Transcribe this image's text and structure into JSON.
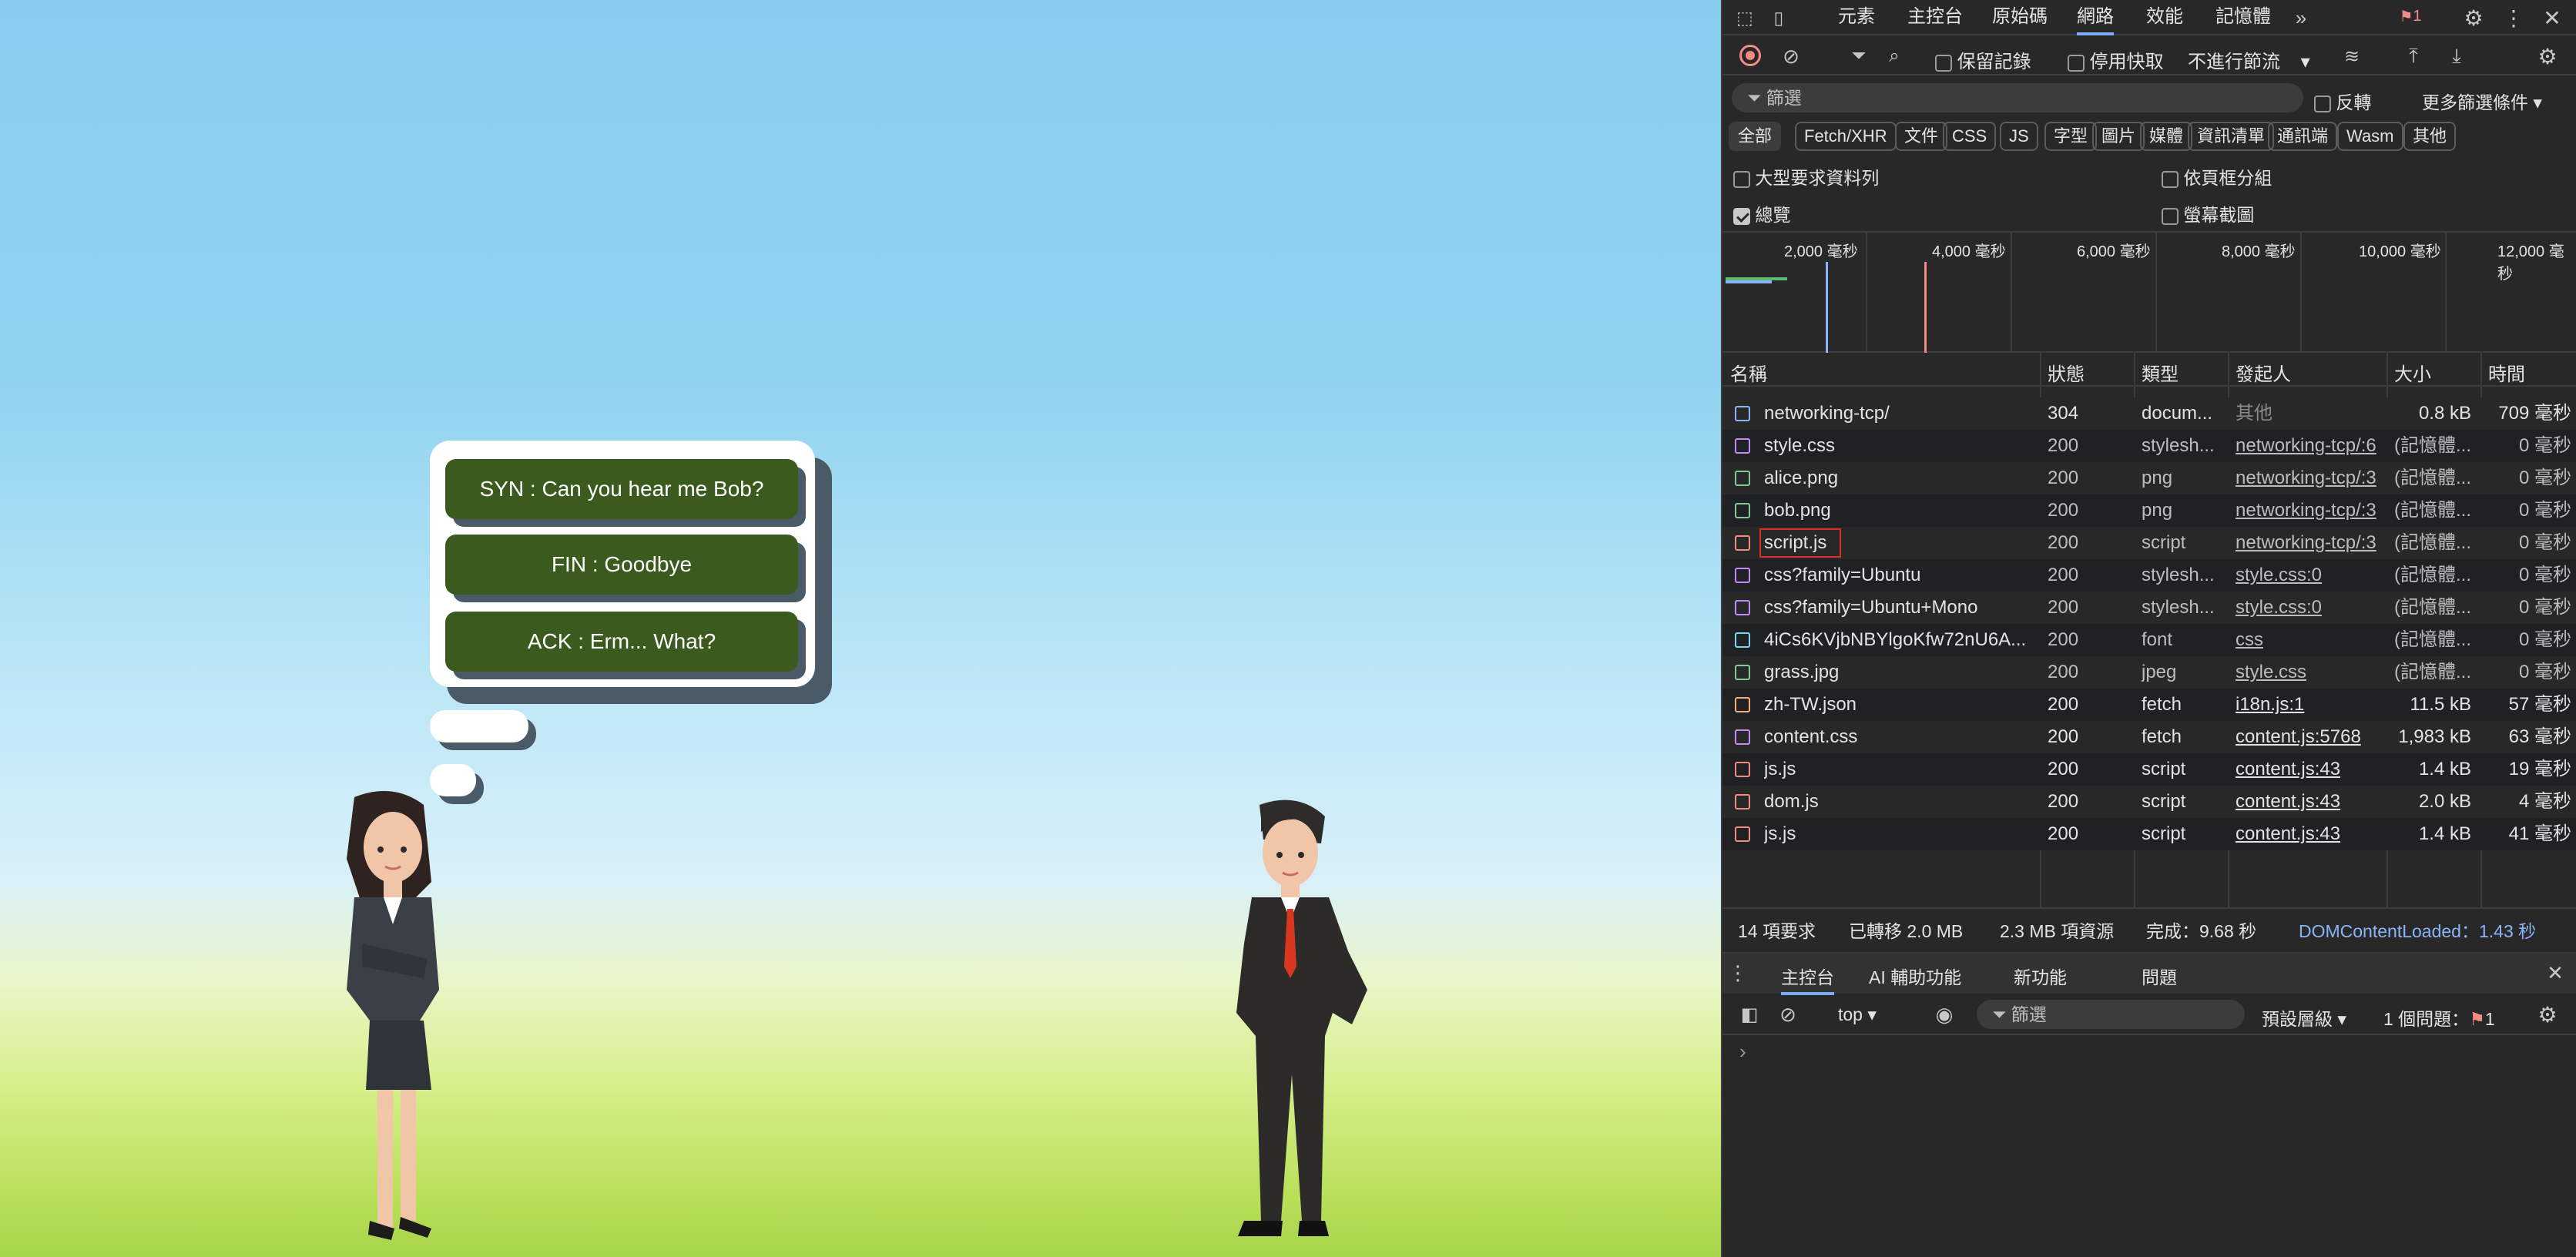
{
  "stage": {
    "bubble_lines": [
      "SYN : Can you hear me Bob?",
      "FIN : Goodbye",
      "ACK : Erm... What?"
    ]
  },
  "devtools": {
    "top_tabs": [
      "元素",
      "主控台",
      "原始碼",
      "網路",
      "效能",
      "記憶體"
    ],
    "active_tab": "網路",
    "issue_badge": "1",
    "toolbar": {
      "preserve_log": "保留記錄",
      "disable_cache": "停用快取",
      "throttle": "不進行節流"
    },
    "filter": {
      "placeholder": "篩選",
      "invert": "反轉",
      "more_filters": "更多篩選條件"
    },
    "type_pills": [
      "全部",
      "Fetch/XHR",
      "文件",
      "CSS",
      "JS",
      "字型",
      "圖片",
      "媒體",
      "資訊清單",
      "通訊端",
      "Wasm",
      "其他"
    ],
    "options": {
      "big_rows": "大型要求資料列",
      "group_by_frame": "依頁框分組",
      "overview": "總覽",
      "screenshots": "螢幕截圖"
    },
    "timeline_ticks": [
      "2,000 毫秒",
      "4,000 毫秒",
      "6,000 毫秒",
      "8,000 毫秒",
      "10,000 毫秒",
      "12,000 毫秒"
    ],
    "columns": {
      "name": "名稱",
      "status": "狀態",
      "type": "類型",
      "initiator": "發起人",
      "size": "大小",
      "time": "時間"
    },
    "requests": [
      {
        "name": "networking-tcp/",
        "status": "304",
        "type": "docum...",
        "initiator": "其他",
        "size": "0.8 kB",
        "time": "709 毫秒",
        "icon": "document-icon"
      },
      {
        "name": "style.css",
        "status": "200",
        "type": "stylesh...",
        "initiator": "networking-tcp/:6",
        "size": "(記憶體...",
        "time": "0 毫秒",
        "icon": "css-icon"
      },
      {
        "name": "alice.png",
        "status": "200",
        "type": "png",
        "initiator": "networking-tcp/:3",
        "size": "(記憶體...",
        "time": "0 毫秒",
        "icon": "image-icon"
      },
      {
        "name": "bob.png",
        "status": "200",
        "type": "png",
        "initiator": "networking-tcp/:3",
        "size": "(記憶體...",
        "time": "0 毫秒",
        "icon": "image-icon"
      },
      {
        "name": "script.js",
        "status": "200",
        "type": "script",
        "initiator": "networking-tcp/:3",
        "size": "(記憶體...",
        "time": "0 毫秒",
        "icon": "script-icon"
      },
      {
        "name": "css?family=Ubuntu",
        "status": "200",
        "type": "stylesh...",
        "initiator": "style.css:0",
        "size": "(記憶體...",
        "time": "0 毫秒",
        "icon": "css-icon"
      },
      {
        "name": "css?family=Ubuntu+Mono",
        "status": "200",
        "type": "stylesh...",
        "initiator": "style.css:0",
        "size": "(記憶體...",
        "time": "0 毫秒",
        "icon": "css-icon"
      },
      {
        "name": "4iCs6KVjbNBYlgoKfw72nU6A...",
        "status": "200",
        "type": "font",
        "initiator": "css",
        "size": "(記憶體...",
        "time": "0 毫秒",
        "icon": "font-icon"
      },
      {
        "name": "grass.jpg",
        "status": "200",
        "type": "jpeg",
        "initiator": "style.css",
        "size": "(記憶體...",
        "time": "0 毫秒",
        "icon": "image-icon"
      },
      {
        "name": "zh-TW.json",
        "status": "200",
        "type": "fetch",
        "initiator": "i18n.js:1",
        "size": "11.5 kB",
        "time": "57 毫秒",
        "icon": "json-icon"
      },
      {
        "name": "content.css",
        "status": "200",
        "type": "fetch",
        "initiator": "content.js:5768",
        "size": "1,983 kB",
        "time": "63 毫秒",
        "icon": "css-icon"
      },
      {
        "name": "js.js",
        "status": "200",
        "type": "script",
        "initiator": "content.js:43",
        "size": "1.4 kB",
        "time": "19 毫秒",
        "icon": "script-icon"
      },
      {
        "name": "dom.js",
        "status": "200",
        "type": "script",
        "initiator": "content.js:43",
        "size": "2.0 kB",
        "time": "4 毫秒",
        "icon": "script-icon"
      },
      {
        "name": "js.js",
        "status": "200",
        "type": "script",
        "initiator": "content.js:43",
        "size": "1.4 kB",
        "time": "41 毫秒",
        "icon": "script-icon"
      }
    ],
    "summary": {
      "requests": "14 項要求",
      "transferred": "已轉移 2.0 MB",
      "resources": "2.3 MB 項資源",
      "finish": "完成：9.68 秒",
      "dcl": "DOMContentLoaded：1.43 秒"
    },
    "drawer": {
      "tabs": [
        "主控台",
        "AI 輔助功能",
        "新功能",
        "問題"
      ],
      "context": "top",
      "filter_placeholder": "篩選",
      "levels": "預設層級",
      "issues_label": "1 個問題：",
      "issues_count": "1"
    }
  }
}
